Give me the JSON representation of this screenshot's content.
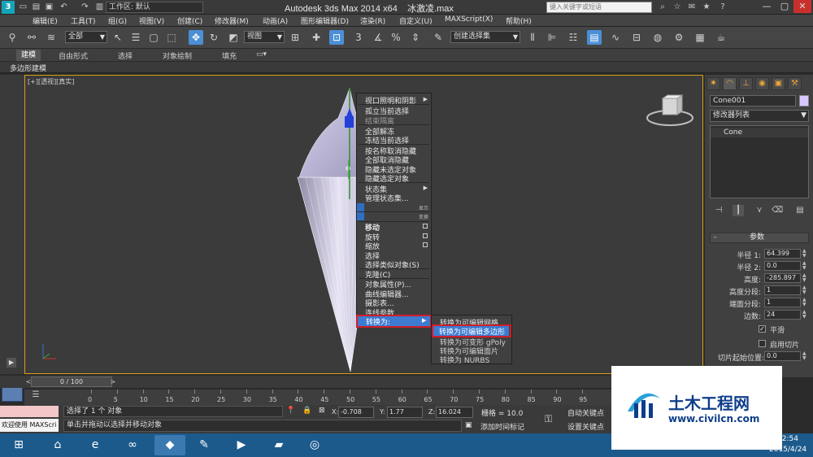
{
  "title_bar": {
    "app_logo_letter": "3",
    "workspace_label": "工作区: 默认",
    "app_title": "Autodesk 3ds Max  2014 x64",
    "file_name": "冰激凌.max",
    "search_placeholder": "键入关键字或短语",
    "window_minimize": "—",
    "window_maximize": "▢",
    "window_close": "✕"
  },
  "menu": {
    "items": [
      "编辑(E)",
      "工具(T)",
      "组(G)",
      "视图(V)",
      "创建(C)",
      "修改器(M)",
      "动画(A)",
      "图形编辑器(D)",
      "渲染(R)",
      "自定义(U)",
      "MAXScript(X)",
      "帮助(H)"
    ]
  },
  "toolbar": {
    "selection_filter": "全部",
    "reference_coord": "视图",
    "snap_3": "3",
    "named_selection": "创建选择集"
  },
  "ribbon": {
    "tabs": [
      "建模",
      "自由形式",
      "选择",
      "对象绘制",
      "填充"
    ],
    "sub_label": "多边形建模"
  },
  "viewport": {
    "label": "[+][透视][真实]"
  },
  "quad_menu": {
    "top_items": [
      {
        "label": "视口照明和阴影",
        "arrow": "▶"
      },
      {
        "label": "孤立当前选择"
      },
      {
        "label": "结束隔离",
        "dim": true
      },
      {
        "label": "全部解冻"
      },
      {
        "label": "冻结当前选择"
      },
      {
        "label": "按名称取消隐藏"
      },
      {
        "label": "全部取消隐藏"
      },
      {
        "label": "隐藏未选定对象"
      },
      {
        "label": "隐藏选定对象"
      },
      {
        "label": "状态集",
        "arrow": "▶"
      },
      {
        "label": "管理状态集..."
      }
    ],
    "display_tag": "显示",
    "transform_tag": "变换",
    "transform_items": [
      {
        "label": "移动",
        "box": true
      },
      {
        "label": "旋转",
        "box": true
      },
      {
        "label": "缩放",
        "box": true
      },
      {
        "label": "选择"
      },
      {
        "label": "选择类似对象(S)"
      },
      {
        "label": "克隆(C)"
      },
      {
        "label": "对象属性(P)..."
      },
      {
        "label": "曲线编辑器..."
      },
      {
        "label": "摄影表..."
      },
      {
        "label": "连线参数..."
      },
      {
        "label": "转换为:",
        "arrow": "▶"
      }
    ],
    "convert_submenu": [
      "转换为可编辑网格",
      "转换为可编辑多边形",
      "转换为可变形 gPoly",
      "转换为可编辑面片",
      "转换为 NURBS"
    ]
  },
  "command_panel": {
    "object_name": "Cone001",
    "object_color": "#d9c8ff",
    "modifier_list": "修改器列表",
    "stack_item": "Cone",
    "rollout_title": "参数",
    "rollout_sign": "-",
    "params": [
      {
        "label": "半径 1:",
        "value": "64.399"
      },
      {
        "label": "半径 2:",
        "value": "0.0"
      },
      {
        "label": "高度:",
        "value": "-285.897"
      },
      {
        "label": "高度分段:",
        "value": "1"
      },
      {
        "label": "端面分段:",
        "value": "1"
      },
      {
        "label": "边数:",
        "value": "24"
      }
    ],
    "smooth_label": "平滑",
    "slice_label": "启用切片",
    "slice_from_label": "切片起始位置:",
    "slice_from_value": "0.0"
  },
  "timeline": {
    "frame_readout": "0 / 100",
    "ticks": [
      "0",
      "5",
      "10",
      "15",
      "20",
      "25",
      "30",
      "35",
      "40",
      "45",
      "50",
      "55",
      "60",
      "65",
      "70",
      "75",
      "80",
      "85",
      "90",
      "95"
    ]
  },
  "status": {
    "selected_text": "选择了 1 个 对象",
    "prompt_text": "单击并拖动以选择并移动对象",
    "welcome_text": "欢迎使用 MAXScri",
    "x_label": "X:",
    "x_value": "-0.708",
    "y_label": "Y:",
    "y_value": "1.77",
    "z_label": "Z:",
    "z_value": "16.024",
    "grid_text": "栅格 = 10.0",
    "auto_key": "自动关键点",
    "set_key": "设置关键点",
    "add_time_tag": "添加时间标记"
  },
  "taskbar": {
    "time": "22:54",
    "date": "2015/4/24"
  },
  "watermark": {
    "title": "土木工程网",
    "url": "www.civilcn.com"
  }
}
